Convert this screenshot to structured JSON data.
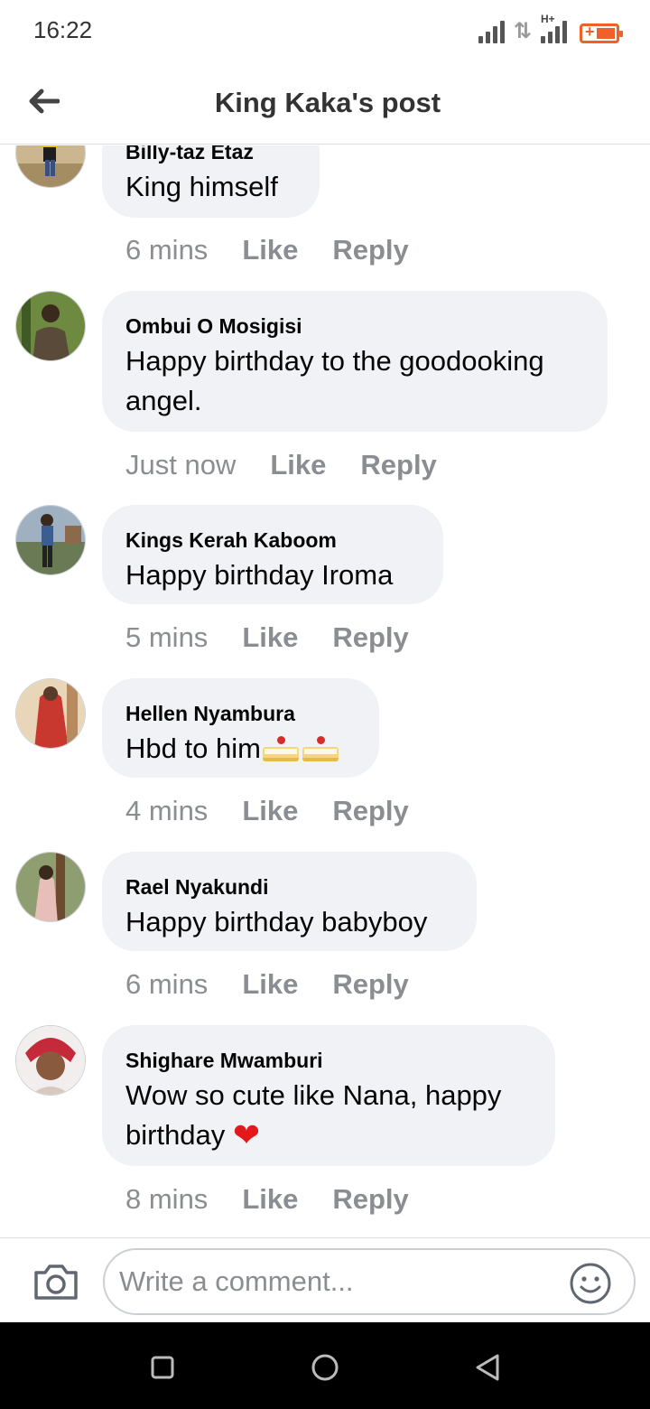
{
  "status_bar": {
    "time": "16:22",
    "network_label": "H+"
  },
  "header": {
    "title": "King Kaka's post"
  },
  "comments": [
    {
      "name": "Billy-taz Etaz",
      "text": "King himself",
      "time": "6 mins",
      "like": "Like",
      "reply": "Reply",
      "avatar_color": "#b9a27c"
    },
    {
      "name": "Ombui O Mosigisi",
      "text": "Happy birthday to the goodooking angel.",
      "time": "Just now",
      "like": "Like",
      "reply": "Reply",
      "avatar_color": "#4e6b32"
    },
    {
      "name": "Kings Kerah Kaboom",
      "text": "Happy birthday Iroma",
      "time": "5 mins",
      "like": "Like",
      "reply": "Reply",
      "avatar_color": "#6f7f92"
    },
    {
      "name": "Hellen Nyambura",
      "text": "Hbd to him",
      "emoji": "cake-cake",
      "time": "4 mins",
      "like": "Like",
      "reply": "Reply",
      "avatar_color": "#c98a5e"
    },
    {
      "name": "Rael Nyakundi",
      "text": "Happy birthday babyboy",
      "time": "6 mins",
      "like": "Like",
      "reply": "Reply",
      "avatar_color": "#9a8a70"
    },
    {
      "name": "Shighare Mwamburi",
      "text": "Wow so cute like Nana, happy birthday",
      "emoji": "red-heart",
      "time": "8 mins",
      "like": "Like",
      "reply": "Reply",
      "avatar_color": "#d9c0b0"
    }
  ],
  "composer": {
    "placeholder": "Write a comment..."
  },
  "colors": {
    "bubble_bg": "#f0f2f5",
    "meta_text": "#8a8d91",
    "battery": "#f0602a"
  },
  "icons": [
    "back-arrow-icon",
    "camera-icon",
    "smiley-icon",
    "nav-recents-icon",
    "nav-home-icon",
    "nav-back-icon"
  ]
}
